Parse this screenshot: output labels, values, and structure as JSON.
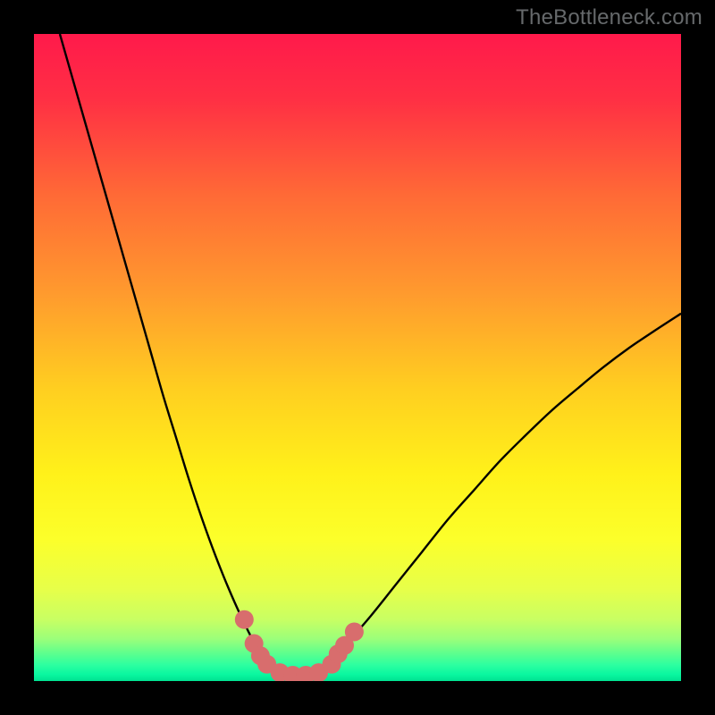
{
  "watermark": "TheBottleneck.com",
  "chart_data": {
    "type": "line",
    "title": "",
    "xlabel": "",
    "ylabel": "",
    "xlim": [
      0,
      100
    ],
    "ylim": [
      0,
      100
    ],
    "grid": false,
    "series": [
      {
        "name": "bottleneck-curve",
        "x": [
          4,
          6,
          8,
          10,
          12,
          14,
          16,
          18,
          20,
          22,
          24,
          26,
          28,
          30,
          32,
          34,
          35,
          36,
          38,
          40,
          42,
          44,
          46,
          48,
          52,
          56,
          60,
          64,
          68,
          72,
          76,
          80,
          84,
          88,
          92,
          96,
          100
        ],
        "y": [
          100,
          93,
          86,
          79,
          72,
          65,
          58,
          51,
          44,
          37.5,
          31,
          25,
          19.5,
          14.5,
          10,
          6,
          4.5,
          3.2,
          1.5,
          0.9,
          0.9,
          1.5,
          3.2,
          5.4,
          10,
          15,
          20,
          25,
          29.5,
          34,
          38,
          41.8,
          45.2,
          48.5,
          51.5,
          54.2,
          56.8
        ]
      }
    ],
    "markers": {
      "name": "highlighted-points",
      "color": "#d86d6d",
      "points": [
        {
          "x": 32.5,
          "y": 9.5
        },
        {
          "x": 34,
          "y": 5.8
        },
        {
          "x": 35,
          "y": 3.9
        },
        {
          "x": 36,
          "y": 2.6
        },
        {
          "x": 38,
          "y": 1.3
        },
        {
          "x": 40,
          "y": 0.9
        },
        {
          "x": 42,
          "y": 0.9
        },
        {
          "x": 44,
          "y": 1.3
        },
        {
          "x": 46,
          "y": 2.6
        },
        {
          "x": 47,
          "y": 4.2
        },
        {
          "x": 48,
          "y": 5.5
        },
        {
          "x": 49.5,
          "y": 7.6
        }
      ]
    },
    "background_gradient": {
      "stops": [
        {
          "offset": 0.0,
          "color": "#ff1a4b"
        },
        {
          "offset": 0.1,
          "color": "#ff2f44"
        },
        {
          "offset": 0.25,
          "color": "#ff6a36"
        },
        {
          "offset": 0.4,
          "color": "#ff9a2e"
        },
        {
          "offset": 0.55,
          "color": "#ffcf20"
        },
        {
          "offset": 0.68,
          "color": "#fff11a"
        },
        {
          "offset": 0.78,
          "color": "#fcff2a"
        },
        {
          "offset": 0.86,
          "color": "#e6ff4a"
        },
        {
          "offset": 0.905,
          "color": "#c8ff63"
        },
        {
          "offset": 0.935,
          "color": "#9bff7a"
        },
        {
          "offset": 0.958,
          "color": "#5bff8e"
        },
        {
          "offset": 0.975,
          "color": "#2dffa0"
        },
        {
          "offset": 0.99,
          "color": "#09f7a0"
        },
        {
          "offset": 1.0,
          "color": "#00e191"
        }
      ]
    }
  }
}
